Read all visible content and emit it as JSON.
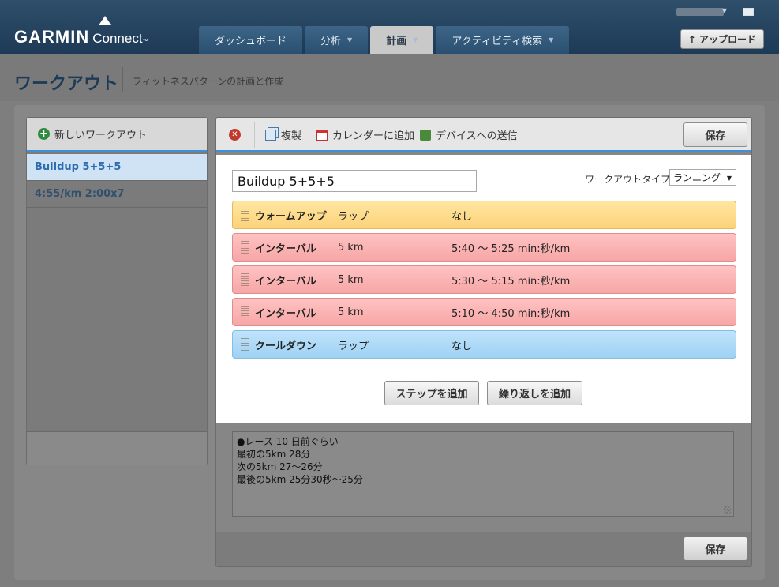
{
  "header": {
    "logo_main": "GARMIN",
    "logo_sub": "Connect",
    "logo_tm": "™",
    "tabs": [
      {
        "label": "ダッシュボード",
        "caret": ""
      },
      {
        "label": "分析",
        "caret": "▼"
      },
      {
        "label": "計画",
        "caret": "▼"
      },
      {
        "label": "アクティビティ検索",
        "caret": "▼"
      }
    ],
    "active_tab": "計画",
    "upload_label": "アップロード"
  },
  "page": {
    "title": "ワークアウト",
    "subtitle": "フィットネスパターンの計画と作成"
  },
  "sidebar": {
    "new_workout_label": "新しいワークアウト",
    "workouts": [
      "Buildup 5+5+5",
      "4:55/km 2:00x7"
    ]
  },
  "toolbar": {
    "copy_label": "複製",
    "calendar_label": "カレンダーに追加",
    "send_label": "デバイスへの送信",
    "save_label": "保存"
  },
  "editor": {
    "workout_name": "Buildup 5+5+5",
    "type_label": "ワークアウトタイプ:",
    "type_value": "ランニング",
    "steps": [
      {
        "name": "ウォームアップ",
        "duration": "ラップ",
        "target": "なし",
        "kind": "warmup"
      },
      {
        "name": "インターバル",
        "duration": "5 km",
        "target": "5:40 ～ 5:25 min:秒/km",
        "kind": "interval"
      },
      {
        "name": "インターバル",
        "duration": "5 km",
        "target": "5:30 ～ 5:15 min:秒/km",
        "kind": "interval"
      },
      {
        "name": "インターバル",
        "duration": "5 km",
        "target": "5:10 ～ 4:50 min:秒/km",
        "kind": "interval"
      },
      {
        "name": "クールダウン",
        "duration": "ラップ",
        "target": "なし",
        "kind": "cooldown"
      }
    ],
    "add_step_label": "ステップを追加",
    "add_repeat_label": "繰り返しを追加",
    "notes": "●レース 10 日前ぐらい\n最初の5km 28分\n次の5km 27～26分\n最後の5km 25分30秒～25分"
  },
  "footer": {
    "save_label": "保存"
  },
  "colors": {
    "header_bg": "#1d3a56",
    "accent_blue": "#3f8fd6",
    "warmup": "#fcd27a",
    "interval": "#f7a6a6",
    "cooldown": "#9fd1f4"
  }
}
